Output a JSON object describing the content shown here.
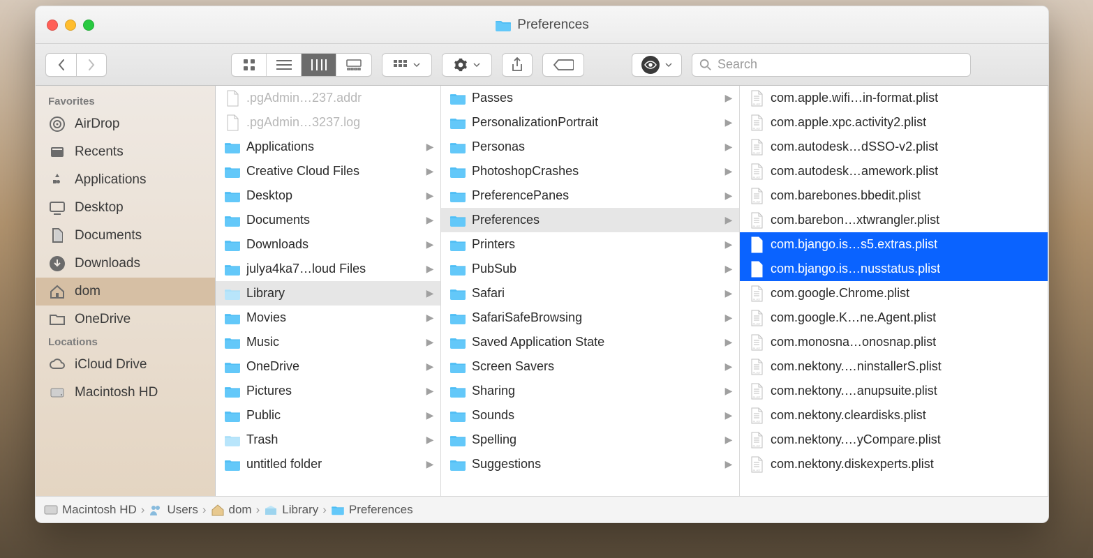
{
  "window": {
    "title": "Preferences"
  },
  "toolbar": {
    "search_placeholder": "Search"
  },
  "sidebar": {
    "sections": [
      {
        "header": "Favorites",
        "items": [
          {
            "label": "AirDrop",
            "icon": "airdrop"
          },
          {
            "label": "Recents",
            "icon": "recents"
          },
          {
            "label": "Applications",
            "icon": "apps"
          },
          {
            "label": "Desktop",
            "icon": "desktop"
          },
          {
            "label": "Documents",
            "icon": "documents"
          },
          {
            "label": "Downloads",
            "icon": "downloads"
          },
          {
            "label": "dom",
            "icon": "home",
            "selected": true
          },
          {
            "label": "OneDrive",
            "icon": "folder"
          }
        ]
      },
      {
        "header": "Locations",
        "items": [
          {
            "label": "iCloud Drive",
            "icon": "cloud"
          },
          {
            "label": "Macintosh HD",
            "icon": "disk"
          }
        ]
      }
    ]
  },
  "columns": [
    {
      "items": [
        {
          "label": ".pgAdmin…237.addr",
          "type": "file",
          "dim": true
        },
        {
          "label": ".pgAdmin…3237.log",
          "type": "file",
          "dim": true
        },
        {
          "label": "Applications",
          "type": "folder",
          "expandable": true
        },
        {
          "label": "Creative Cloud Files",
          "type": "folder",
          "expandable": true
        },
        {
          "label": "Desktop",
          "type": "folder",
          "expandable": true
        },
        {
          "label": "Documents",
          "type": "folder",
          "expandable": true
        },
        {
          "label": "Downloads",
          "type": "folder",
          "expandable": true
        },
        {
          "label": "julya4ka7…loud Files",
          "type": "folder",
          "expandable": true
        },
        {
          "label": "Library",
          "type": "folder-dim",
          "expandable": true,
          "selected": "col"
        },
        {
          "label": "Movies",
          "type": "folder",
          "expandable": true
        },
        {
          "label": "Music",
          "type": "folder",
          "expandable": true
        },
        {
          "label": "OneDrive",
          "type": "folder",
          "expandable": true
        },
        {
          "label": "Pictures",
          "type": "folder",
          "expandable": true
        },
        {
          "label": "Public",
          "type": "folder",
          "expandable": true
        },
        {
          "label": "Trash",
          "type": "folder-dim",
          "expandable": true
        },
        {
          "label": "untitled folder",
          "type": "folder",
          "expandable": true
        }
      ]
    },
    {
      "items": [
        {
          "label": "Passes",
          "type": "folder",
          "expandable": true
        },
        {
          "label": "PersonalizationPortrait",
          "type": "folder",
          "expandable": true
        },
        {
          "label": "Personas",
          "type": "folder",
          "expandable": true
        },
        {
          "label": "PhotoshopCrashes",
          "type": "folder",
          "expandable": true
        },
        {
          "label": "PreferencePanes",
          "type": "folder",
          "expandable": true
        },
        {
          "label": "Preferences",
          "type": "folder",
          "expandable": true,
          "selected": "col"
        },
        {
          "label": "Printers",
          "type": "folder",
          "expandable": true
        },
        {
          "label": "PubSub",
          "type": "folder",
          "expandable": true
        },
        {
          "label": "Safari",
          "type": "folder",
          "expandable": true
        },
        {
          "label": "SafariSafeBrowsing",
          "type": "folder",
          "expandable": true
        },
        {
          "label": "Saved Application State",
          "type": "folder",
          "expandable": true
        },
        {
          "label": "Screen Savers",
          "type": "folder",
          "expandable": true
        },
        {
          "label": "Sharing",
          "type": "folder",
          "expandable": true
        },
        {
          "label": "Sounds",
          "type": "folder",
          "expandable": true
        },
        {
          "label": "Spelling",
          "type": "folder",
          "expandable": true
        },
        {
          "label": "Suggestions",
          "type": "folder",
          "expandable": true
        }
      ]
    },
    {
      "items": [
        {
          "label": "com.apple.wifi…in-format.plist",
          "type": "plist"
        },
        {
          "label": "com.apple.xpc.activity2.plist",
          "type": "plist"
        },
        {
          "label": "com.autodesk…dSSO-v2.plist",
          "type": "plist"
        },
        {
          "label": "com.autodesk…amework.plist",
          "type": "plist"
        },
        {
          "label": "com.barebones.bbedit.plist",
          "type": "plist"
        },
        {
          "label": "com.barebon…xtwrangler.plist",
          "type": "plist"
        },
        {
          "label": "com.bjango.is…s5.extras.plist",
          "type": "plist",
          "selected": "blue"
        },
        {
          "label": "com.bjango.is…nusstatus.plist",
          "type": "plist",
          "selected": "blue"
        },
        {
          "label": "com.google.Chrome.plist",
          "type": "plist"
        },
        {
          "label": "com.google.K…ne.Agent.plist",
          "type": "plist"
        },
        {
          "label": "com.monosna…onosnap.plist",
          "type": "plist"
        },
        {
          "label": "com.nektony.…ninstallerS.plist",
          "type": "plist"
        },
        {
          "label": "com.nektony.…anupsuite.plist",
          "type": "plist"
        },
        {
          "label": "com.nektony.cleardisks.plist",
          "type": "plist"
        },
        {
          "label": "com.nektony.…yCompare.plist",
          "type": "plist"
        },
        {
          "label": "com.nektony.diskexperts.plist",
          "type": "plist"
        }
      ]
    }
  ],
  "pathbar": [
    {
      "label": "Macintosh HD",
      "icon": "disk"
    },
    {
      "label": "Users",
      "icon": "users"
    },
    {
      "label": "dom",
      "icon": "home"
    },
    {
      "label": "Library",
      "icon": "library"
    },
    {
      "label": "Preferences",
      "icon": "folder"
    }
  ]
}
